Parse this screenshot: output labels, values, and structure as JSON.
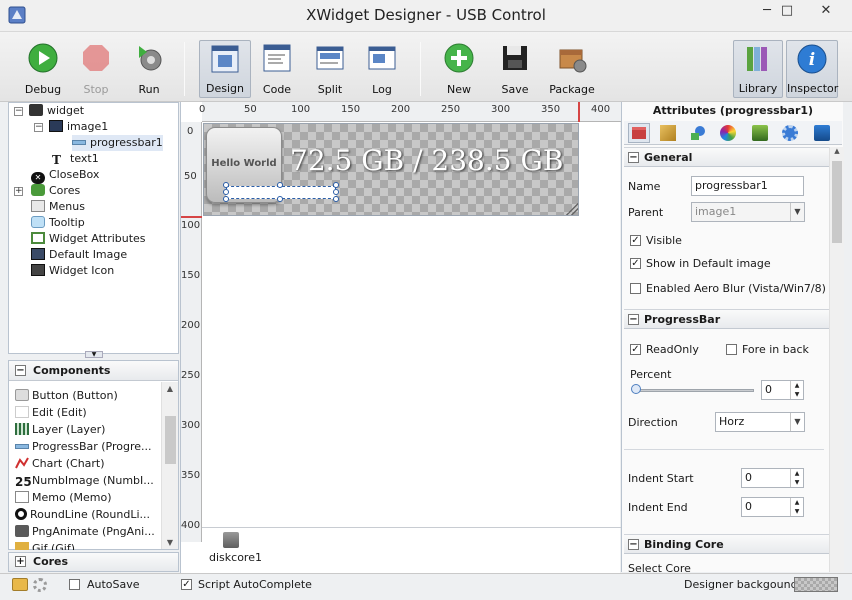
{
  "window": {
    "title": "XWidget Designer - USB Control",
    "minimize": "─",
    "maximize": "□",
    "close": "✕"
  },
  "toolbar": {
    "debug": "Debug",
    "stop": "Stop",
    "run": "Run",
    "design": "Design",
    "code": "Code",
    "split": "Split",
    "log": "Log",
    "new": "New",
    "save": "Save",
    "package": "Package",
    "library": "Library",
    "inspector": "Inspector"
  },
  "tree": {
    "root": "widget",
    "image1": "image1",
    "progressbar1": "progressbar1",
    "text1": "text1",
    "closebox": "CloseBox",
    "cores": "Cores",
    "menus": "Menus",
    "tooltip": "Tooltip",
    "widget_attributes": "Widget Attributes",
    "default_image": "Default Image",
    "widget_icon": "Widget Icon"
  },
  "components": {
    "header": "Components",
    "items": [
      "Button (Button)",
      "Edit (Edit)",
      "Layer (Layer)",
      "ProgressBar (Progre...",
      "Chart (Chart)",
      "NumbImage (NumbI...",
      "Memo (Memo)",
      "RoundLine (RoundLi...",
      "PngAnimate (PngAni...",
      "Gif (Gif)"
    ]
  },
  "cores_header": "Cores",
  "canvas": {
    "ruler_h": [
      "0",
      "50",
      "100",
      "150",
      "200",
      "250",
      "300",
      "350",
      "400"
    ],
    "ruler_v": [
      "0",
      "50",
      "100",
      "150",
      "200",
      "250",
      "300",
      "350",
      "400"
    ],
    "hello": "Hello World",
    "usage": "72.5 GB / 238.5 GB",
    "core_label": "diskcore1"
  },
  "attributes": {
    "title": "Attributes (progressbar1)",
    "general": {
      "header": "General",
      "name_label": "Name",
      "name_value": "progressbar1",
      "parent_label": "Parent",
      "parent_value": "image1",
      "visible": "Visible",
      "visible_checked": true,
      "show_default": "Show in Default image",
      "show_default_checked": true,
      "aero": "Enabled Aero Blur (Vista/Win7/8)",
      "aero_checked": false
    },
    "progressbar": {
      "header": "ProgressBar",
      "readonly": "ReadOnly",
      "readonly_checked": true,
      "fore_in_back": "Fore in back",
      "fore_in_back_checked": false,
      "percent_label": "Percent",
      "percent_value": "0",
      "percent_fraction": 0,
      "direction_label": "Direction",
      "direction_value": "Horz",
      "indent_start_label": "Indent Start",
      "indent_start_value": "0",
      "indent_end_label": "Indent End",
      "indent_end_value": "0"
    },
    "binding": {
      "header": "Binding Core",
      "select_core": "Select Core"
    }
  },
  "status": {
    "autosave": "AutoSave",
    "autosave_checked": false,
    "script_autocomplete": "Script AutoComplete",
    "script_autocomplete_checked": true,
    "designer_background": "Designer backgound"
  },
  "colors": {
    "accent": "#3a7bd5",
    "checker_light": "#c8c8c8",
    "checker_dark": "#a9a9a9",
    "guide_red": "#d64545"
  }
}
